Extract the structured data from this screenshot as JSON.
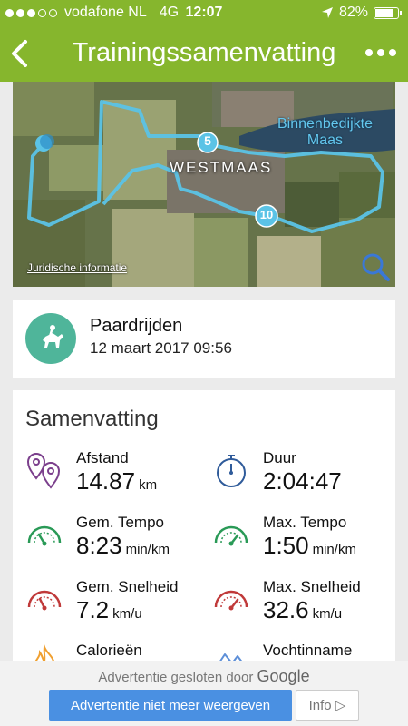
{
  "status_bar": {
    "carrier": "vodafone NL",
    "network": "4G",
    "time": "12:07",
    "battery": "82%",
    "battery_level": 0.82
  },
  "nav": {
    "title": "Trainingssamenvatting",
    "back_icon": "chevron-left-icon",
    "more_icon": "more-dots-icon"
  },
  "map": {
    "town_label": "WESTMAAS",
    "water_label_line1": "Binnenbedijkte",
    "water_label_line2": "Maas",
    "legal_link": "Juridische informatie",
    "marker_5": "5",
    "marker_10": "10",
    "route_color": "#5bc3e6"
  },
  "activity": {
    "name": "Paardrijden",
    "date": "12 maart 2017 09:56",
    "icon": "horse-riding-icon",
    "icon_color": "#4fb59a"
  },
  "summary": {
    "title": "Samenvatting",
    "stats": [
      {
        "label": "Afstand",
        "value": "14.87",
        "unit": "km",
        "icon": "location-pins-icon"
      },
      {
        "label": "Duur",
        "value": "2:04:47",
        "unit": "",
        "icon": "stopwatch-icon"
      },
      {
        "label": "Gem. Tempo",
        "value": "8:23",
        "unit": "min/km",
        "icon": "tempo-gauge-icon"
      },
      {
        "label": "Max. Tempo",
        "value": "1:50",
        "unit": "min/km",
        "icon": "tempo-gauge-icon"
      },
      {
        "label": "Gem. Snelheid",
        "value": "7.2",
        "unit": "km/u",
        "icon": "speed-gauge-icon"
      },
      {
        "label": "Max. Snelheid",
        "value": "32.6",
        "unit": "km/u",
        "icon": "speed-gauge-icon"
      },
      {
        "label": "Calorieën",
        "value": "",
        "unit": "",
        "icon": "flame-icon"
      },
      {
        "label": "Vochtinname",
        "value": "",
        "unit": "",
        "icon": "mountain-icon"
      }
    ]
  },
  "ad": {
    "closed_text": "Advertentie gesloten door",
    "brand": "Google",
    "stop_button": "Advertentie niet meer weergeven",
    "info_button": "Info ▷"
  },
  "colors": {
    "brand_green": "#86b62d",
    "pace_green": "#2a9a57",
    "speed_red": "#c03a3a",
    "distance_purple": "#7b3f8c",
    "duration_blue": "#2f5b9a",
    "calorie_orange": "#f0a030",
    "hydration_blue": "#5d8fd8"
  }
}
